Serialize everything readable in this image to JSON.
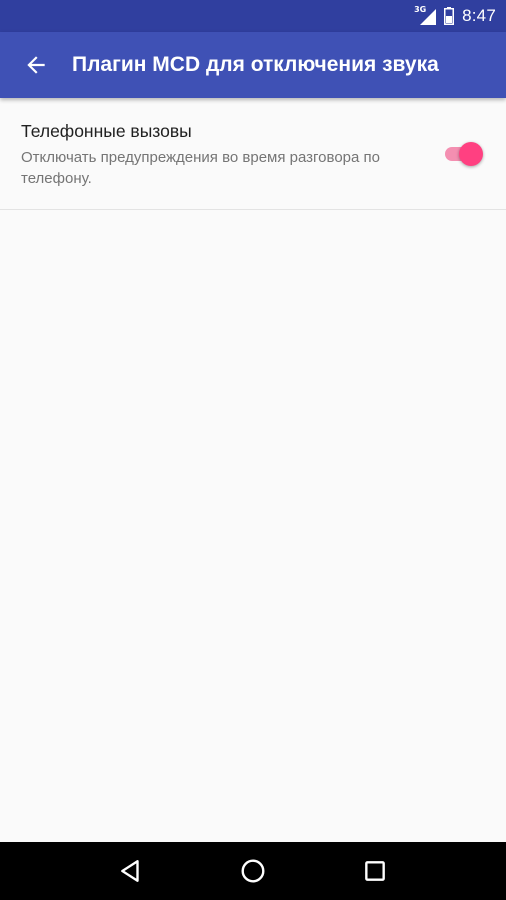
{
  "status_bar": {
    "network_type": "3G",
    "time": "8:47",
    "icons": [
      "signal-icon",
      "battery-icon"
    ]
  },
  "app_bar": {
    "back_icon": "arrow-back-icon",
    "title": "Плагин MCD для отключения звука"
  },
  "preferences": [
    {
      "title": "Телефонные вызовы",
      "summary": "Отключать предупреждения во время разговора по телефону.",
      "enabled": true
    }
  ],
  "nav_bar": {
    "icons": [
      "back-triangle-icon",
      "home-circle-icon",
      "recents-square-icon"
    ]
  },
  "colors": {
    "status_bar": "#303f9f",
    "app_bar": "#3f51b5",
    "accent": "#ff4081",
    "accent_track": "#f48fb1",
    "background": "#fafafa"
  }
}
